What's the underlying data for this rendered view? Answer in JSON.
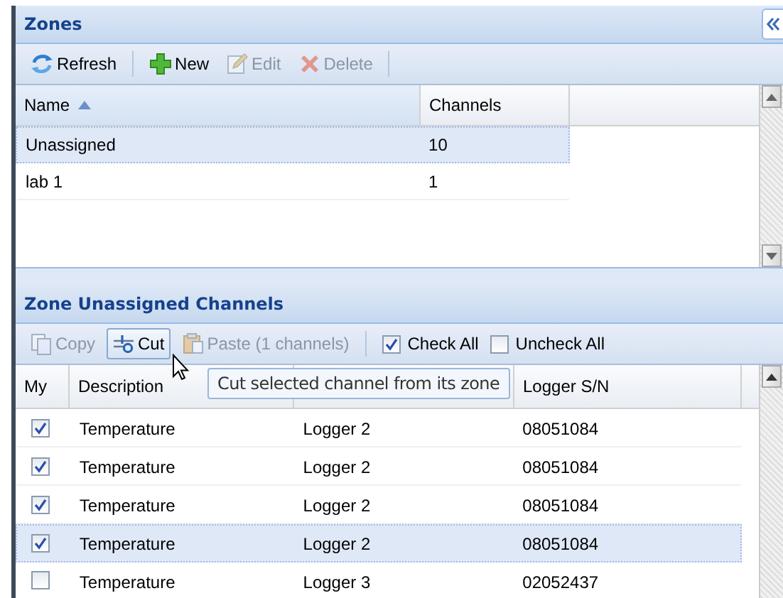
{
  "zones": {
    "title": "Zones",
    "toolbar": [
      {
        "kind": "refresh",
        "label": "Refresh",
        "disabled": false
      },
      {
        "kind": "separator"
      },
      {
        "kind": "add",
        "label": "New",
        "disabled": false
      },
      {
        "kind": "edit",
        "label": "Edit",
        "disabled": true
      },
      {
        "kind": "delete",
        "label": "Delete",
        "disabled": true
      },
      {
        "kind": "separator"
      }
    ],
    "columns": [
      {
        "label": "Name",
        "sorted": true
      },
      {
        "label": "Channels",
        "sorted": false
      }
    ],
    "rows": [
      {
        "name": "Unassigned",
        "channels": "10",
        "selected": true
      },
      {
        "name": "lab 1",
        "channels": "1",
        "selected": false
      }
    ]
  },
  "channels": {
    "title": "Zone Unassigned Channels",
    "toolbar": [
      {
        "kind": "copy",
        "label": "Copy",
        "disabled": true,
        "hovered": false
      },
      {
        "kind": "cut",
        "label": "Cut",
        "disabled": false,
        "hovered": true
      },
      {
        "kind": "paste",
        "label": "Paste (1 channels)",
        "disabled": true,
        "hovered": false
      },
      {
        "kind": "separator"
      },
      {
        "kind": "checkbox",
        "label": "Check All",
        "checked": true
      },
      {
        "kind": "checkbox",
        "label": "Uncheck All",
        "checked": false
      }
    ],
    "columns": [
      {
        "label": "My"
      },
      {
        "label": "Description"
      },
      {
        "label": "Logger S/N"
      }
    ],
    "rows": [
      {
        "checked": true,
        "description": "Temperature",
        "logger": "Logger 2",
        "serial": "08051084",
        "selected": false
      },
      {
        "checked": true,
        "description": "Temperature",
        "logger": "Logger 2",
        "serial": "08051084",
        "selected": false
      },
      {
        "checked": true,
        "description": "Temperature",
        "logger": "Logger 2",
        "serial": "08051084",
        "selected": false
      },
      {
        "checked": true,
        "description": "Temperature",
        "logger": "Logger 2",
        "serial": "08051084",
        "selected": true
      },
      {
        "checked": false,
        "description": "Temperature",
        "logger": "Logger 3",
        "serial": "02052437",
        "selected": false
      }
    ],
    "tooltip": "Cut selected channel from its zone"
  }
}
